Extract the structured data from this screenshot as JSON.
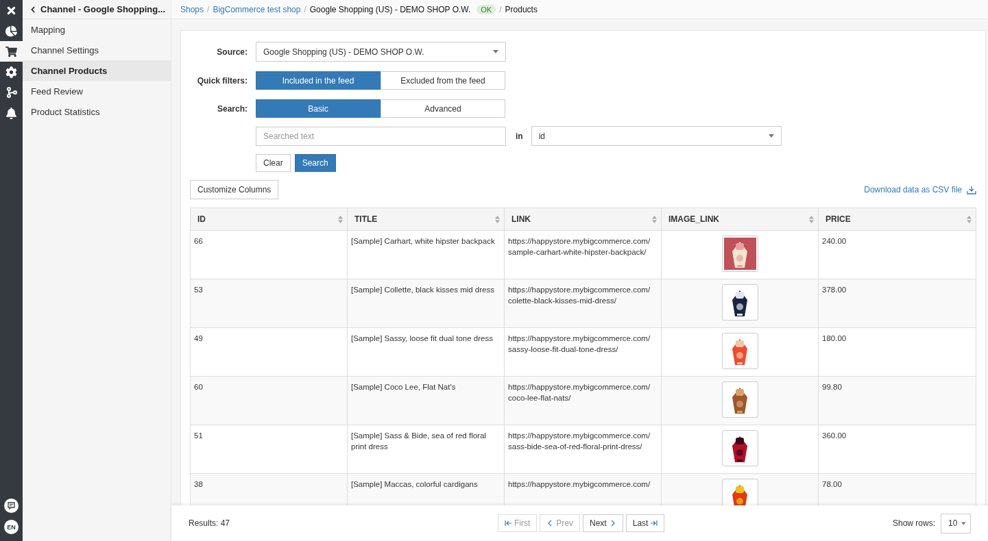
{
  "rail": [
    {
      "selected": false
    },
    {
      "selected": false
    },
    {
      "selected": true
    },
    {
      "selected": false
    },
    {
      "selected": false
    },
    {
      "selected": false
    }
  ],
  "rail_bottom": {
    "language": "EN"
  },
  "sidebar": {
    "title": "Channel - Google Shopping...",
    "items": [
      {
        "label": "Mapping",
        "selected": false
      },
      {
        "label": "Channel Settings",
        "selected": false
      },
      {
        "label": "Channel Products",
        "selected": true
      },
      {
        "label": "Feed Review",
        "selected": false
      },
      {
        "label": "Product Statistics",
        "selected": false
      }
    ]
  },
  "breadcrumb": [
    {
      "label": "Shops",
      "link": true
    },
    {
      "separator": "/",
      "label": "BigCommerce test shop",
      "link": true
    },
    {
      "separator": "/",
      "label": "Google Shopping (US) - DEMO SHOP O.W.",
      "link": false,
      "badge": "OK"
    },
    {
      "separator": "/",
      "label": "Products",
      "link": false
    }
  ],
  "form": {
    "source_label": "Source:",
    "source_value": "Google Shopping (US) - DEMO SHOP O.W.",
    "quick_filters_label": "Quick filters:",
    "quick_filters": [
      {
        "label": "Included in the feed",
        "selected": true
      },
      {
        "label": "Excluded from the feed",
        "selected": false
      }
    ],
    "search_label": "Search:",
    "search_modes": [
      {
        "label": "Basic",
        "selected": true
      },
      {
        "label": "Advanced",
        "selected": false
      }
    ],
    "search_placeholder": "Searched text",
    "in_label": "in",
    "field_value": "id",
    "buttons": [
      {
        "label": "Clear",
        "kind": "default"
      },
      {
        "label": "Search",
        "kind": "primary"
      }
    ]
  },
  "customize_button": "Customize Columns",
  "download_link": "Download data as CSV file",
  "table": {
    "columns": [
      "ID",
      "TITLE",
      "LINK",
      "IMAGE_LINK",
      "PRICE"
    ],
    "rows": [
      {
        "id": "66",
        "title": "[Sample] Carhart, white hipster backpack",
        "link": "https://happystore.mybigcommerce.com/ sample-carhart-white-hipster-backpack/",
        "price": "240.00"
      },
      {
        "id": "53",
        "title": "[Sample] Collette, black kisses mid dress",
        "link": "https://happystore.mybigcommerce.com/ colette-black-kisses-mid-dress/",
        "price": "378.00"
      },
      {
        "id": "49",
        "title": "[Sample] Sassy, loose fit dual tone dress",
        "link": "https://happystore.mybigcommerce.com/ sassy-loose-fit-dual-tone-dress/",
        "price": "180.00"
      },
      {
        "id": "60",
        "title": "[Sample] Coco Lee, Flat Nat's",
        "link": "https://happystore.mybigcommerce.com/ coco-lee-flat-nats/",
        "price": "99.80"
      },
      {
        "id": "51",
        "title": "[Sample] Sass & Bide, sea of red floral print dress",
        "link": "https://happystore.mybigcommerce.com/ sass-bide-sea-of-red-floral-print-dress/",
        "price": "360.00"
      },
      {
        "id": "38",
        "title": "[Sample] Maccas, colorful cardigans",
        "link": "https://happystore.mybigcommerce.com/",
        "price": "78.00"
      }
    ]
  },
  "footer": {
    "results": "Results: 47",
    "pager": [
      {
        "label": "First",
        "kind": "first",
        "disabled": true
      },
      {
        "label": "Prev",
        "kind": "prev",
        "disabled": true
      },
      {
        "label": "Next",
        "kind": "next",
        "disabled": false
      },
      {
        "label": "Last",
        "kind": "last",
        "disabled": false
      }
    ],
    "show_rows_label": "Show rows:",
    "show_rows_value": "10"
  }
}
